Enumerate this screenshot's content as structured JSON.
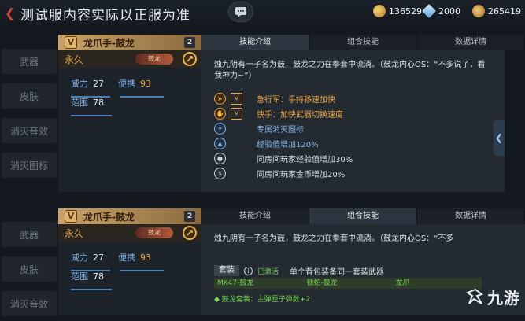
{
  "topbar": {
    "notice": "测试服内容实际以正服为准",
    "currencies": [
      {
        "icon": "gold-coin-icon",
        "value": "136529",
        "color": "#e1b04a"
      },
      {
        "icon": "diamond-icon",
        "value": "2000",
        "color": "#8fc4f0"
      },
      {
        "icon": "voucher-icon",
        "value": "265419",
        "color": "#d9a34a"
      }
    ]
  },
  "nav_top": [
    "武器",
    "皮肤",
    "消灭音效",
    "消灭图标"
  ],
  "nav_bottom": [
    "武器",
    "皮肤",
    "消灭音效"
  ],
  "panel1": {
    "name": "龙爪手-鼓龙",
    "level": "2",
    "duration": "永久",
    "badge": "鼓龙",
    "stats": {
      "power_k": "威力",
      "power_v": "27",
      "carry_k": "便携",
      "carry_v": "93",
      "range_k": "范围",
      "range_v": "78"
    },
    "tabs": [
      "技能介绍",
      "组合技能",
      "数据详情"
    ],
    "active_tab": 0,
    "desc": "烛九阴有一子名为鼓，鼓龙之力在拳套中流淌。（鼓龙内心OS：“不多说了，看我神力~”）",
    "perks": [
      {
        "text": "急行军：手持移速加快",
        "style": "orange"
      },
      {
        "text": "快手：加快武器切换速度",
        "style": "orange"
      },
      {
        "text": "专属消灭图标",
        "style": "blue"
      },
      {
        "text": "经验值增加120%",
        "style": "blue"
      },
      {
        "text": "同房间玩家经验值增加30%",
        "style": "white"
      },
      {
        "text": "同房间玩家金币增加20%",
        "style": "white"
      }
    ]
  },
  "panel2": {
    "name": "龙爪手-鼓龙",
    "level": "2",
    "duration": "永久",
    "badge": "鼓龙",
    "stats": {
      "power_k": "威力",
      "power_v": "27",
      "carry_k": "便携",
      "carry_v": "93",
      "range_k": "范围",
      "range_v": "78"
    },
    "tabs": [
      "技能介绍",
      "组合技能",
      "数据详情"
    ],
    "active_tab": 1,
    "desc": "烛九阴有一子名为鼓，鼓龙之力在拳套中流淌。（鼓龙内心OS：“不多",
    "set_label": "套装",
    "set_status": "已激活",
    "set_hint": "单个背包装备同一套装武器",
    "set_items": [
      "MK47-鼓龙",
      "锁蛇-鼓龙",
      "龙爪"
    ],
    "set_bonus": "鼓龙套装：主弹匣子弹数+2"
  },
  "watermark": "九游"
}
